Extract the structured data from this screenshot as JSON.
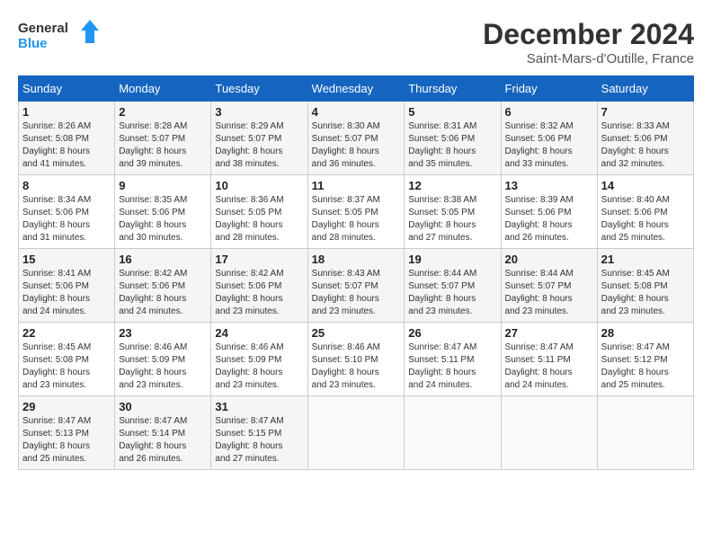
{
  "logo": {
    "line1": "General",
    "line2": "Blue"
  },
  "title": "December 2024",
  "subtitle": "Saint-Mars-d'Outille, France",
  "days_of_week": [
    "Sunday",
    "Monday",
    "Tuesday",
    "Wednesday",
    "Thursday",
    "Friday",
    "Saturday"
  ],
  "weeks": [
    [
      {
        "num": "1",
        "info": "Sunrise: 8:26 AM\nSunset: 5:08 PM\nDaylight: 8 hours\nand 41 minutes."
      },
      {
        "num": "2",
        "info": "Sunrise: 8:28 AM\nSunset: 5:07 PM\nDaylight: 8 hours\nand 39 minutes."
      },
      {
        "num": "3",
        "info": "Sunrise: 8:29 AM\nSunset: 5:07 PM\nDaylight: 8 hours\nand 38 minutes."
      },
      {
        "num": "4",
        "info": "Sunrise: 8:30 AM\nSunset: 5:07 PM\nDaylight: 8 hours\nand 36 minutes."
      },
      {
        "num": "5",
        "info": "Sunrise: 8:31 AM\nSunset: 5:06 PM\nDaylight: 8 hours\nand 35 minutes."
      },
      {
        "num": "6",
        "info": "Sunrise: 8:32 AM\nSunset: 5:06 PM\nDaylight: 8 hours\nand 33 minutes."
      },
      {
        "num": "7",
        "info": "Sunrise: 8:33 AM\nSunset: 5:06 PM\nDaylight: 8 hours\nand 32 minutes."
      }
    ],
    [
      {
        "num": "8",
        "info": "Sunrise: 8:34 AM\nSunset: 5:06 PM\nDaylight: 8 hours\nand 31 minutes."
      },
      {
        "num": "9",
        "info": "Sunrise: 8:35 AM\nSunset: 5:06 PM\nDaylight: 8 hours\nand 30 minutes."
      },
      {
        "num": "10",
        "info": "Sunrise: 8:36 AM\nSunset: 5:05 PM\nDaylight: 8 hours\nand 28 minutes."
      },
      {
        "num": "11",
        "info": "Sunrise: 8:37 AM\nSunset: 5:05 PM\nDaylight: 8 hours\nand 28 minutes."
      },
      {
        "num": "12",
        "info": "Sunrise: 8:38 AM\nSunset: 5:05 PM\nDaylight: 8 hours\nand 27 minutes."
      },
      {
        "num": "13",
        "info": "Sunrise: 8:39 AM\nSunset: 5:06 PM\nDaylight: 8 hours\nand 26 minutes."
      },
      {
        "num": "14",
        "info": "Sunrise: 8:40 AM\nSunset: 5:06 PM\nDaylight: 8 hours\nand 25 minutes."
      }
    ],
    [
      {
        "num": "15",
        "info": "Sunrise: 8:41 AM\nSunset: 5:06 PM\nDaylight: 8 hours\nand 24 minutes."
      },
      {
        "num": "16",
        "info": "Sunrise: 8:42 AM\nSunset: 5:06 PM\nDaylight: 8 hours\nand 24 minutes."
      },
      {
        "num": "17",
        "info": "Sunrise: 8:42 AM\nSunset: 5:06 PM\nDaylight: 8 hours\nand 23 minutes."
      },
      {
        "num": "18",
        "info": "Sunrise: 8:43 AM\nSunset: 5:07 PM\nDaylight: 8 hours\nand 23 minutes."
      },
      {
        "num": "19",
        "info": "Sunrise: 8:44 AM\nSunset: 5:07 PM\nDaylight: 8 hours\nand 23 minutes."
      },
      {
        "num": "20",
        "info": "Sunrise: 8:44 AM\nSunset: 5:07 PM\nDaylight: 8 hours\nand 23 minutes."
      },
      {
        "num": "21",
        "info": "Sunrise: 8:45 AM\nSunset: 5:08 PM\nDaylight: 8 hours\nand 23 minutes."
      }
    ],
    [
      {
        "num": "22",
        "info": "Sunrise: 8:45 AM\nSunset: 5:08 PM\nDaylight: 8 hours\nand 23 minutes."
      },
      {
        "num": "23",
        "info": "Sunrise: 8:46 AM\nSunset: 5:09 PM\nDaylight: 8 hours\nand 23 minutes."
      },
      {
        "num": "24",
        "info": "Sunrise: 8:46 AM\nSunset: 5:09 PM\nDaylight: 8 hours\nand 23 minutes."
      },
      {
        "num": "25",
        "info": "Sunrise: 8:46 AM\nSunset: 5:10 PM\nDaylight: 8 hours\nand 23 minutes."
      },
      {
        "num": "26",
        "info": "Sunrise: 8:47 AM\nSunset: 5:11 PM\nDaylight: 8 hours\nand 24 minutes."
      },
      {
        "num": "27",
        "info": "Sunrise: 8:47 AM\nSunset: 5:11 PM\nDaylight: 8 hours\nand 24 minutes."
      },
      {
        "num": "28",
        "info": "Sunrise: 8:47 AM\nSunset: 5:12 PM\nDaylight: 8 hours\nand 25 minutes."
      }
    ],
    [
      {
        "num": "29",
        "info": "Sunrise: 8:47 AM\nSunset: 5:13 PM\nDaylight: 8 hours\nand 25 minutes."
      },
      {
        "num": "30",
        "info": "Sunrise: 8:47 AM\nSunset: 5:14 PM\nDaylight: 8 hours\nand 26 minutes."
      },
      {
        "num": "31",
        "info": "Sunrise: 8:47 AM\nSunset: 5:15 PM\nDaylight: 8 hours\nand 27 minutes."
      },
      null,
      null,
      null,
      null
    ]
  ]
}
